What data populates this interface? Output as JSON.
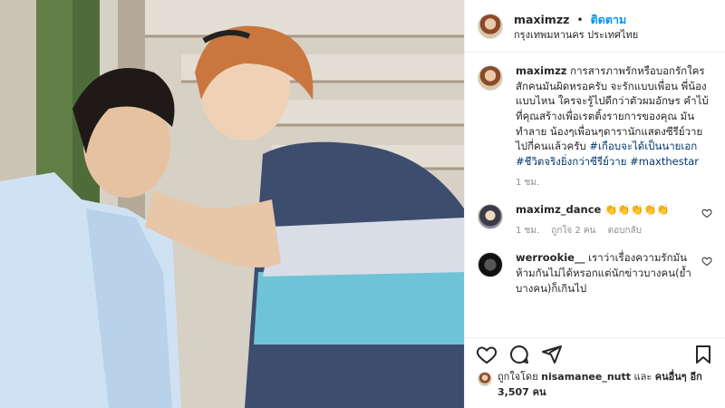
{
  "post": {
    "username": "maximzz",
    "separator": "•",
    "follow_label": "ติดตาม",
    "location": "กรุงเทพมหานคร ประเทศไทย"
  },
  "caption": {
    "username": "maximzz",
    "text": "การสารภาพรักหรือบอกรักใครสักคนมันผิดหรอครับ จะรักแบบเพื่อน พี่น้อง แบบไหน ใครจะรู้ไปดีกว่าตัวผมอักษร คำไบ้ ที่คุณสร้างเพื่อเรตติ้งรายการของคุณ มันทำลาย น้องๆเพื่อนๆดารานักแสดงซีรีย์วายไปกี่คนแล้วครับ",
    "hashtags": "#เกือบจะได้เป็นนายเอก #ชีวิตจริงยิ่งกว่าซีรีย์วาย #maxthestar",
    "time": "1 ชม."
  },
  "comments": [
    {
      "username": "maximz_dance",
      "text": "👏👏👏👏👏",
      "time": "1 ชม.",
      "likes": "ถูกใจ 2 คน",
      "reply": "ตอบกลับ"
    },
    {
      "username": "werrookie__",
      "text": "เราว่าเรื่องความรักมันห้ามกันไม่ได้หรอกแต่นักข่าวบางคน(ย้ำบางคน)ก็เกินไป"
    }
  ],
  "likes_line": {
    "prefix": "ถูกใจโดย",
    "user": "nisamanee_nutt",
    "and": "และ",
    "others": "คนอื่นๆ อีก 3,507 คน"
  }
}
